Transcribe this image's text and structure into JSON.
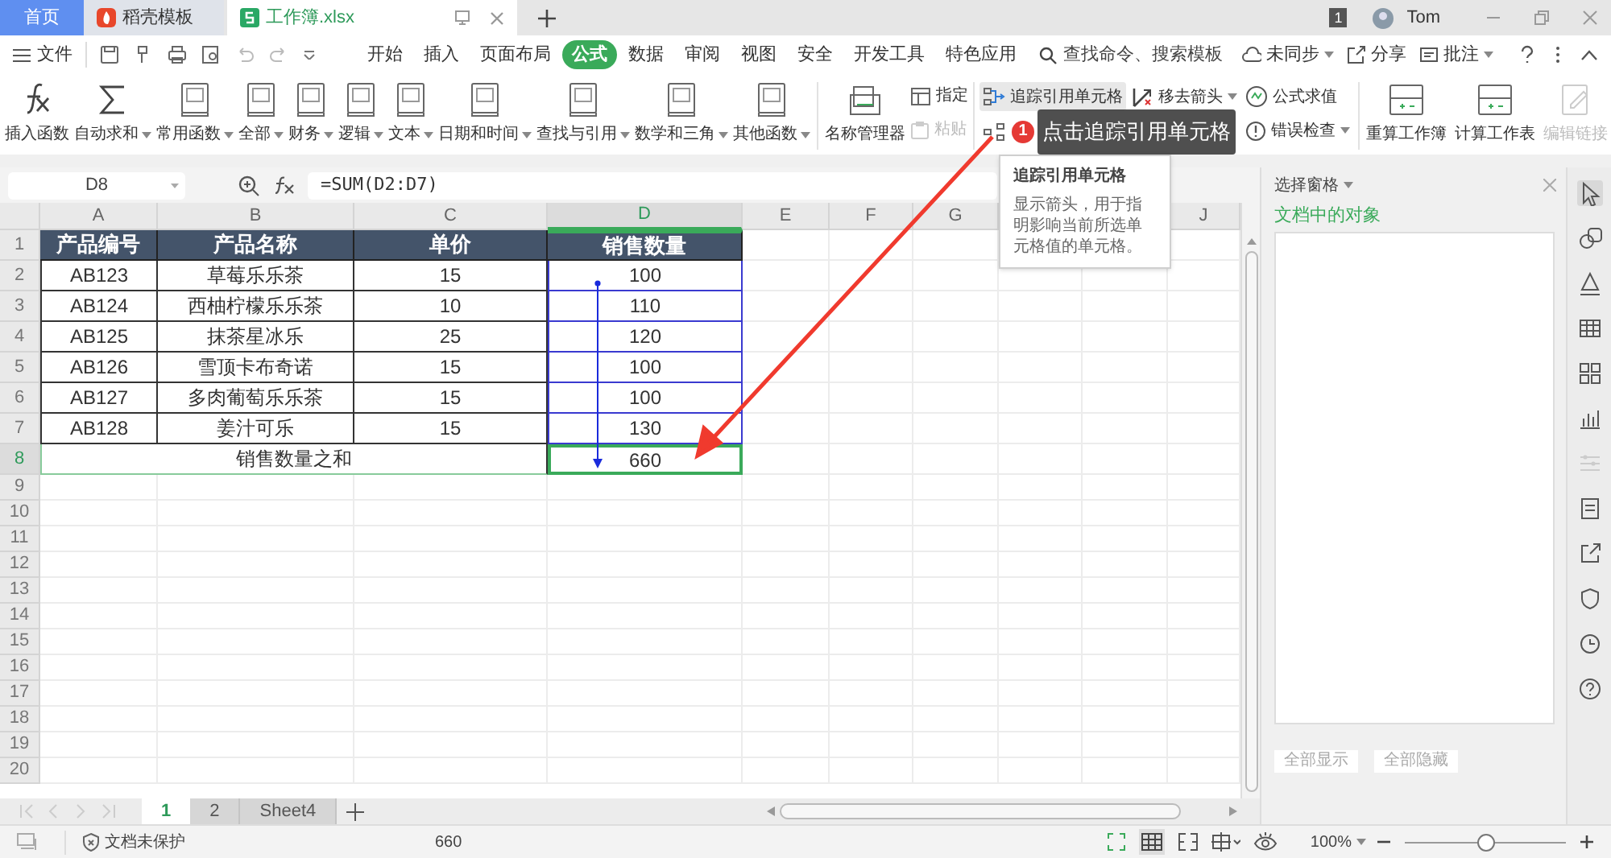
{
  "tabs": [
    {
      "label": "首页",
      "selected": false,
      "kind": "home"
    },
    {
      "label": "稻壳模板",
      "selected": false,
      "kind": "docer"
    },
    {
      "label": "工作簿.xlsx",
      "selected": true,
      "kind": "sheet"
    }
  ],
  "account": {
    "badge": "1",
    "user": "Tom"
  },
  "menu": {
    "file": "文件",
    "tabs": [
      {
        "label": "开始",
        "selected": false
      },
      {
        "label": "插入",
        "selected": false
      },
      {
        "label": "页面布局",
        "selected": false
      },
      {
        "label": "公式",
        "selected": true
      },
      {
        "label": "数据",
        "selected": false
      },
      {
        "label": "审阅",
        "selected": false
      },
      {
        "label": "视图",
        "selected": false
      },
      {
        "label": "安全",
        "selected": false
      },
      {
        "label": "开发工具",
        "selected": false
      },
      {
        "label": "特色应用",
        "selected": false
      }
    ],
    "search": {
      "placeholder": "查找命令、搜索模板"
    },
    "actions": [
      {
        "label": "未同步",
        "dropdown": true
      },
      {
        "label": "分享",
        "dropdown": false
      },
      {
        "label": "批注",
        "dropdown": true
      }
    ]
  },
  "ribbon": {
    "functions": [
      {
        "label": "插入函数",
        "dropdown": false,
        "kind": "fx"
      },
      {
        "label": "自动求和",
        "dropdown": true,
        "kind": "sigma"
      },
      {
        "label": "常用函数",
        "dropdown": true,
        "kind": "book"
      },
      {
        "label": "全部",
        "dropdown": true,
        "kind": "book"
      },
      {
        "label": "财务",
        "dropdown": true,
        "kind": "book"
      },
      {
        "label": "逻辑",
        "dropdown": true,
        "kind": "book"
      },
      {
        "label": "文本",
        "dropdown": true,
        "kind": "book"
      },
      {
        "label": "日期和时间",
        "dropdown": true,
        "kind": "book"
      },
      {
        "label": "查找与引用",
        "dropdown": true,
        "kind": "book"
      },
      {
        "label": "数学和三角",
        "dropdown": true,
        "kind": "book"
      },
      {
        "label": "其他函数",
        "dropdown": true,
        "kind": "book"
      }
    ],
    "name_manager": "名称管理器",
    "name_tools": [
      {
        "label": "指定",
        "disabled": false
      },
      {
        "label": "粘贴",
        "disabled": true
      }
    ],
    "audit": [
      {
        "label": "追踪引用单元格",
        "dropdown": false,
        "hover": true
      },
      {
        "label": "移去箭头",
        "dropdown": true,
        "hover": false
      },
      {
        "label": "公式求值",
        "dropdown": false,
        "hover": false
      },
      {
        "label": "错误检查",
        "dropdown": true,
        "hover": false
      }
    ],
    "calc": [
      {
        "label": "重算工作簿",
        "disabled": false
      },
      {
        "label": "计算工作表",
        "disabled": false
      },
      {
        "label": "编辑链接",
        "disabled": true
      }
    ]
  },
  "callout": {
    "badge": "1",
    "text": "点击追踪引用单元格"
  },
  "tooltip": {
    "title": "追踪引用单元格",
    "body": "显示箭头，用于指明影响当前所选单元格值的单元格。"
  },
  "formula_bar": {
    "cell": "D8",
    "formula": "=SUM(D2:D7)"
  },
  "sheet": {
    "columns": [
      {
        "label": "A",
        "selected": false
      },
      {
        "label": "B",
        "selected": false
      },
      {
        "label": "C",
        "selected": false
      },
      {
        "label": "D",
        "selected": true
      },
      {
        "label": "E",
        "selected": false
      },
      {
        "label": "F",
        "selected": false
      },
      {
        "label": "G",
        "selected": false
      },
      null,
      null,
      {
        "label": "J",
        "selected": false
      }
    ],
    "rows": [
      {
        "label": "1",
        "selected": false
      },
      {
        "label": "2",
        "selected": false
      },
      {
        "label": "3",
        "selected": false
      },
      {
        "label": "4",
        "selected": false
      },
      {
        "label": "5",
        "selected": false
      },
      {
        "label": "6",
        "selected": false
      },
      {
        "label": "7",
        "selected": false
      },
      {
        "label": "8",
        "selected": true
      },
      {
        "label": "9",
        "selected": false
      },
      {
        "label": "10",
        "selected": false
      },
      {
        "label": "11",
        "selected": false
      },
      {
        "label": "12",
        "selected": false
      },
      {
        "label": "13",
        "selected": false
      },
      {
        "label": "14",
        "selected": false
      },
      {
        "label": "15",
        "selected": false
      },
      {
        "label": "16",
        "selected": false
      },
      {
        "label": "17",
        "selected": false
      },
      {
        "label": "18",
        "selected": false
      },
      {
        "label": "19",
        "selected": false
      },
      {
        "label": "20",
        "selected": false
      }
    ],
    "header": [
      "产品编号",
      "产品名称",
      "单价",
      "销售数量"
    ],
    "data": [
      [
        "AB123",
        "草莓乐乐茶",
        "15",
        "100"
      ],
      [
        "AB124",
        "西柚柠檬乐乐茶",
        "10",
        "110"
      ],
      [
        "AB125",
        "抹茶星冰乐",
        "25",
        "120"
      ],
      [
        "AB126",
        "雪顶卡布奇诺",
        "15",
        "100"
      ],
      [
        "AB127",
        "多肉葡萄乐乐茶",
        "15",
        "100"
      ],
      [
        "AB128",
        "姜汁可乐",
        "15",
        "130"
      ]
    ],
    "total": {
      "label": "销售数量之和",
      "value": "660"
    }
  },
  "pane": {
    "title": "选择窗格",
    "subtitle": "文档中的对象",
    "buttons": [
      "全部显示",
      "全部隐藏"
    ]
  },
  "sheet_tabs": [
    {
      "label": "1",
      "selected": true
    },
    {
      "label": "2",
      "selected": false
    },
    {
      "label": "Sheet4",
      "selected": false
    }
  ],
  "status": {
    "protection": "文档未保护",
    "sum": "660",
    "zoom": "100%",
    "zoom_slider": {
      "level": 0.5
    }
  }
}
